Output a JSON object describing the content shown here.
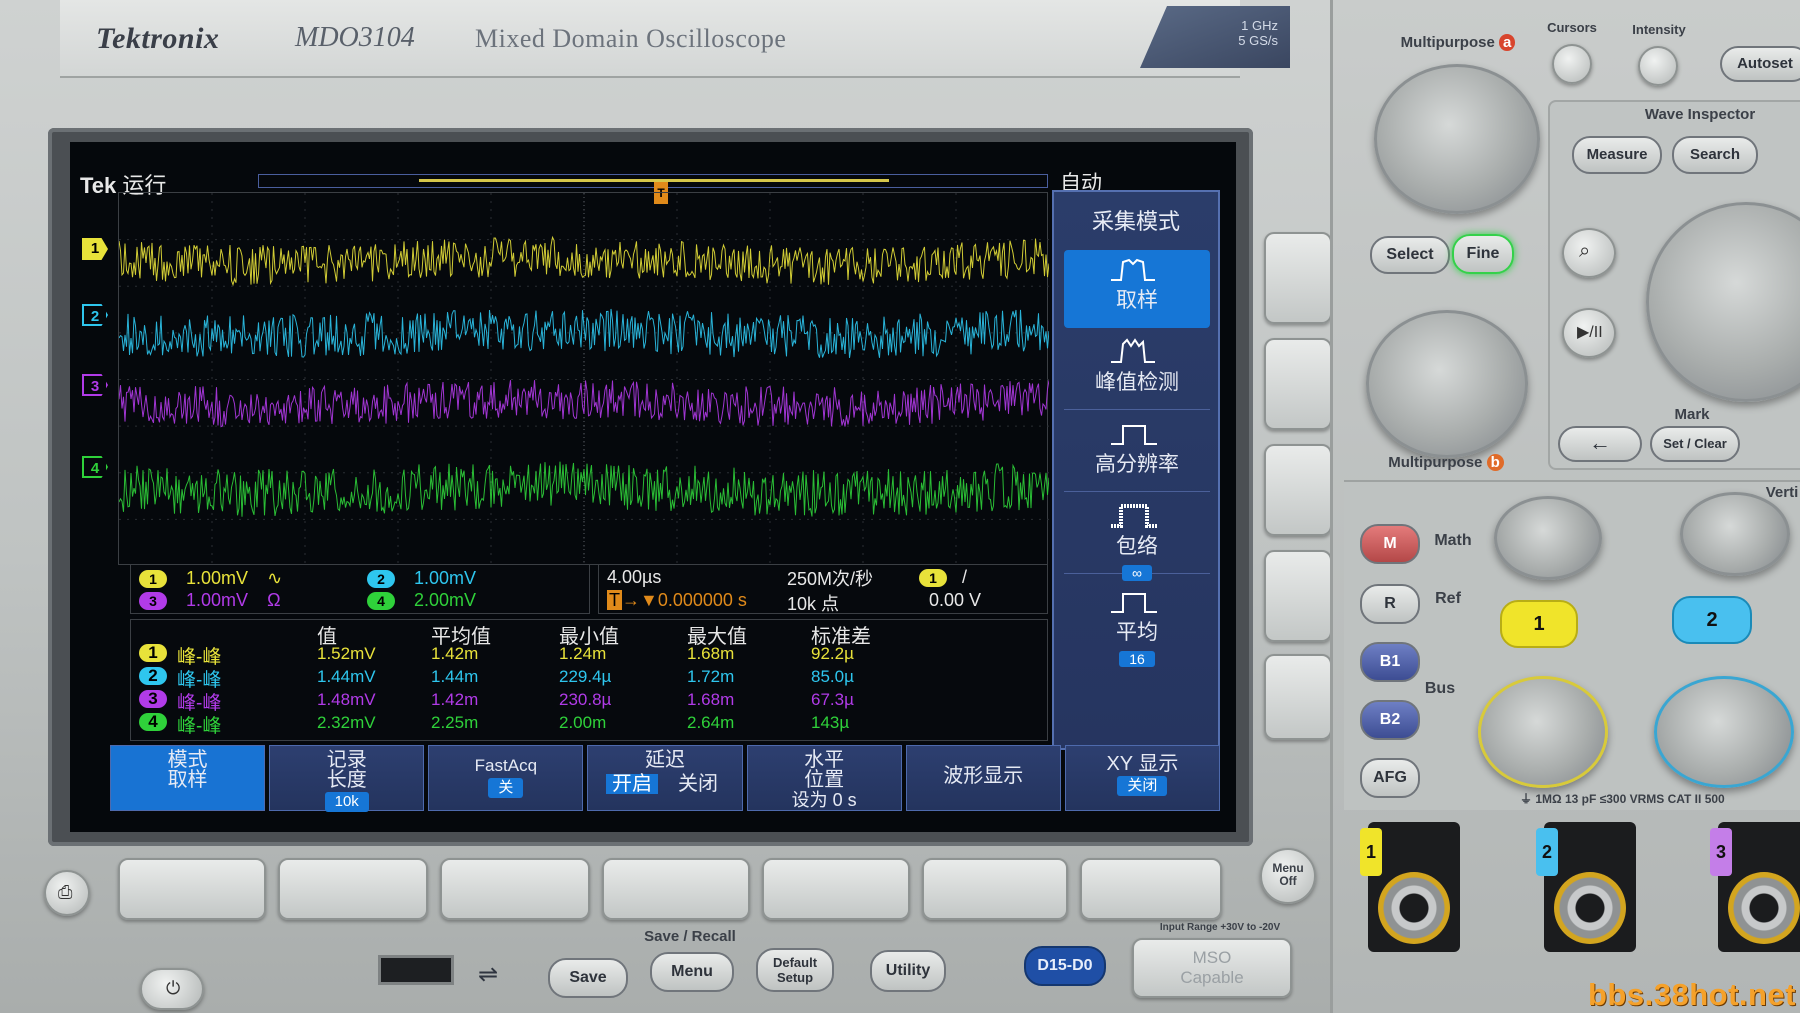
{
  "brand": {
    "logo": "Tektronix",
    "model": "MDO3104",
    "description": "Mixed Domain Oscilloscope",
    "spec_line1": "1 GHz",
    "spec_line2": "5 GS/s"
  },
  "status": {
    "tek": "Tek",
    "run_state": "运行",
    "trigger_mode": "自动"
  },
  "channels": [
    {
      "id": "1",
      "scale": "1.00mV",
      "coupling_icon": "∿",
      "color": "#e8e23a"
    },
    {
      "id": "2",
      "scale": "1.00mV",
      "color": "#2ec6ee"
    },
    {
      "id": "3",
      "scale": "1.00mV",
      "impedance_icon": "Ω",
      "color": "#b13be8"
    },
    {
      "id": "4",
      "scale": "2.00mV",
      "color": "#2fd13a"
    }
  ],
  "timebase": {
    "scale": "4.00µs",
    "sample_rate": "250M次/秒",
    "delay": "0.000000 s",
    "record": "10k 点",
    "trigger_channel": "1",
    "trigger_slope": "/",
    "trigger_level": "0.00 V"
  },
  "measurements": {
    "headers": [
      "值",
      "平均值",
      "最小值",
      "最大值",
      "标准差"
    ],
    "rows": [
      {
        "ch": "1",
        "name": "峰-峰",
        "value": "1.52mV",
        "mean": "1.42m",
        "min": "1.24m",
        "max": "1.68m",
        "std": "92.2µ"
      },
      {
        "ch": "2",
        "name": "峰-峰",
        "value": "1.44mV",
        "mean": "1.44m",
        "min": "229.4µ",
        "max": "1.72m",
        "std": "85.0µ"
      },
      {
        "ch": "3",
        "name": "峰-峰",
        "value": "1.48mV",
        "mean": "1.42m",
        "min": "230.8µ",
        "max": "1.68m",
        "std": "67.3µ"
      },
      {
        "ch": "4",
        "name": "峰-峰",
        "value": "2.32mV",
        "mean": "2.25m",
        "min": "2.00m",
        "max": "2.64m",
        "std": "143µ"
      }
    ]
  },
  "side_menu": {
    "title": "采集模式",
    "items": [
      {
        "label": "取样",
        "selected": true
      },
      {
        "label": "峰值检测"
      },
      {
        "label": "高分辨率"
      },
      {
        "label": "包络",
        "sub": "∞"
      },
      {
        "label": "平均",
        "sub": "16"
      }
    ]
  },
  "bottom_menu": {
    "mode": {
      "line1": "模式",
      "line2": "取样"
    },
    "record": {
      "line1": "记录",
      "line2": "长度",
      "tag": "10k"
    },
    "fastacq": {
      "line1": "FastAcq",
      "tag": "关"
    },
    "delay": {
      "line1": "延迟",
      "on": "开启",
      "off": "关闭"
    },
    "hpos": {
      "line1": "水平",
      "line2": "位置",
      "line3": "设为 0 s"
    },
    "waveform": {
      "line1": "波形显示"
    },
    "xy": {
      "line1": "XY 显示",
      "tag": "关闭"
    }
  },
  "hardware": {
    "multipurpose_a": "Multipurpose",
    "badge_a": "a",
    "multipurpose_b": "Multipurpose",
    "badge_b": "b",
    "cursors": "Cursors",
    "intensity": "Intensity",
    "autoset": "Autoset",
    "wave_inspector": "Wave Inspector",
    "measure": "Measure",
    "search": "Search",
    "select": "Select",
    "fine": "Fine",
    "mark": "Mark",
    "set_clear": "Set / Clear",
    "math": "Math",
    "ref": "Ref",
    "bus": "Bus",
    "vertical": "Verti",
    "m": "M",
    "r": "R",
    "b1": "B1",
    "b2": "B2",
    "afg": "AFG",
    "ch1": "1",
    "ch2": "2",
    "menu_off_1": "Menu",
    "menu_off_2": "Off",
    "save_recall": "Save / Recall",
    "save": "Save",
    "menu": "Menu",
    "default_setup_1": "Default",
    "default_setup_2": "Setup",
    "utility": "Utility",
    "d15_d0": "D15-D0",
    "mso_1": "MSO",
    "mso_2": "Capable",
    "input_range": "Input Range +30V to -20V",
    "rating": "⏚ 1MΩ 13 pF ≤300 VRMS CAT II 500",
    "bnc_1": "1",
    "bnc_2": "2",
    "bnc_3": "3"
  },
  "watermark": "bbs.38hot.net"
}
